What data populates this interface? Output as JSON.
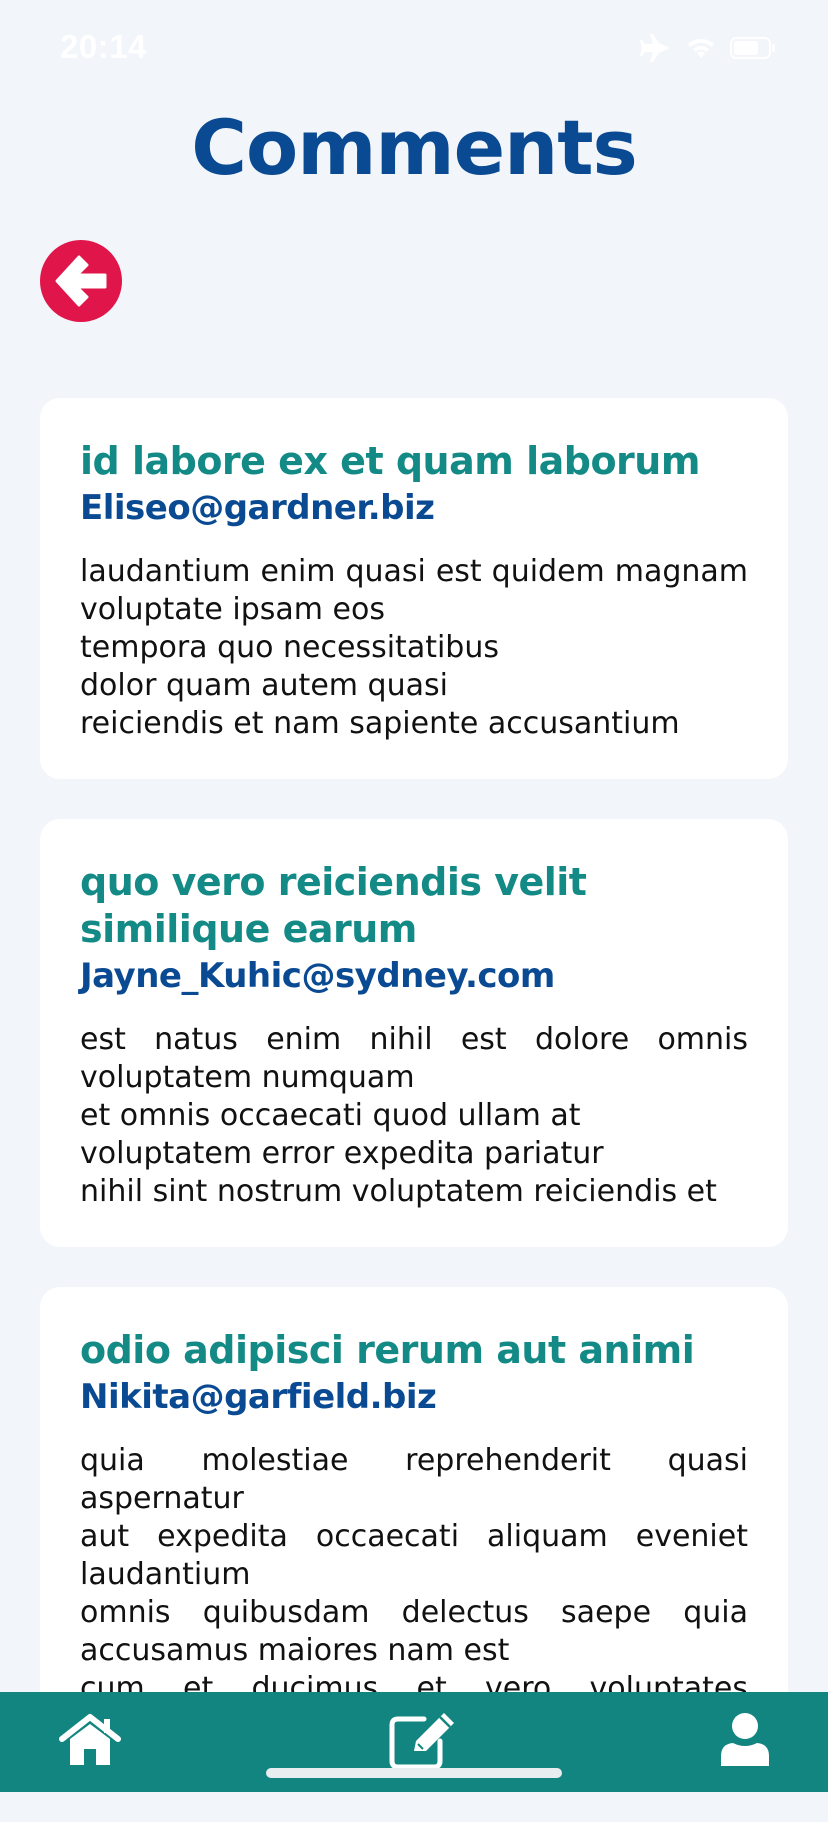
{
  "status_bar": {
    "time": "20:14",
    "icons": [
      "airplane-mode-icon",
      "wifi-icon",
      "battery-icon"
    ]
  },
  "header": {
    "title": "Comments"
  },
  "back_button": {
    "icon": "arrow-left-circle-icon",
    "color": "#e0164a"
  },
  "comments": [
    {
      "title": "id labore ex et quam laborum",
      "email": "Eliseo@gardner.biz",
      "body": "laudantium enim quasi est quidem magnam voluptate ipsam eos\ntempora quo necessitatibus\ndolor quam autem quasi\nreiciendis et nam sapiente accusantium"
    },
    {
      "title": "quo vero reiciendis velit similique earum",
      "email": "Jayne_Kuhic@sydney.com",
      "body": "est natus enim nihil est dolore omnis voluptatem numquam\net omnis occaecati quod ullam at\nvoluptatem error expedita pariatur\nnihil sint nostrum voluptatem reiciendis et"
    },
    {
      "title": "odio adipisci rerum aut animi",
      "email": "Nikita@garfield.biz",
      "body": "quia molestiae reprehenderit quasi aspernatur\naut expedita occaecati aliquam eveniet laudantium\nomnis quibusdam delectus saepe quia accusamus maiores nam est\ncum et ducimus et vero voluptates excepturi deleniti ratione"
    }
  ],
  "tab_bar": {
    "tabs": [
      {
        "icon": "home-icon"
      },
      {
        "icon": "edit-icon"
      },
      {
        "icon": "user-icon"
      }
    ],
    "colors": {
      "background": "#138580",
      "primary": "#0a4a92",
      "accent": "#138a85"
    }
  }
}
